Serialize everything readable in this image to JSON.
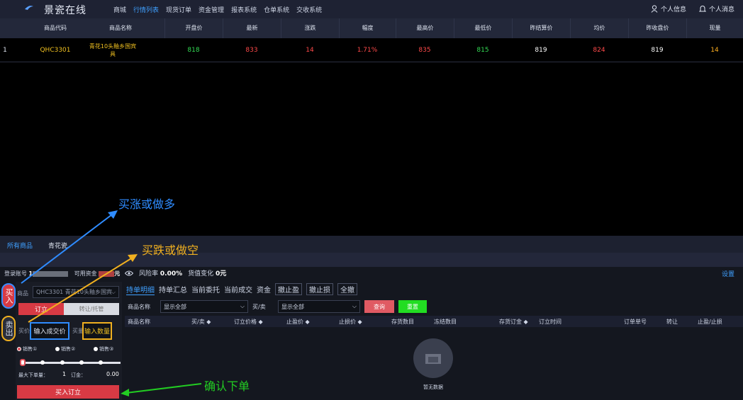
{
  "topbar": {
    "brand": "景瓷在线",
    "nav": [
      "商城",
      "行情列表",
      "现货订单",
      "资金管理",
      "报表系统",
      "仓单系统",
      "交收系统"
    ],
    "active_nav": 1,
    "user_info": "个人信息",
    "user_msg": "个人消息"
  },
  "market": {
    "headers": [
      "商品代码",
      "商品名称",
      "开盘价",
      "最新",
      "涨跌",
      "幅度",
      "最高价",
      "最低价",
      "昨结算价",
      "均价",
      "昨收盘价",
      "现量"
    ],
    "row": {
      "idx": "1",
      "code": "QHC3301",
      "name": "青花10头釉乡国宾具",
      "open": "818",
      "last": "833",
      "change": "14",
      "pct": "1.71%",
      "high": "835",
      "low": "815",
      "prev_settle": "819",
      "avg": "824",
      "prev_close": "819",
      "vol": "14"
    }
  },
  "band": {
    "tab_all": "所有商品",
    "tab_qhc": "青花瓷"
  },
  "account": {
    "login_label": "登录账号",
    "login_value": "1",
    "funds_label": "可用资金",
    "funds_unit": "元",
    "risk_label": "风险率",
    "risk_value": "0.00%",
    "change_label": "货值变化",
    "change_value": "0元",
    "settings": "设置"
  },
  "order": {
    "buy_tab": "买入",
    "sell_tab": "卖出",
    "product_label": "商品",
    "product_value": "QHC3301  青花10头釉乡国宾",
    "tab_order": "订立",
    "tab_transfer": "转让/托管",
    "price_label": "买价",
    "price_placeholder": "输入成交价",
    "qty_label": "买量",
    "qty_placeholder": "输入数量",
    "radios": [
      "销售①",
      "销售②",
      "销售③"
    ],
    "max_label": "最大下单量：",
    "max_value": "1",
    "order_label": "订金：",
    "order_value": "0.00",
    "submit": "买入订立"
  },
  "holdings": {
    "tabs": [
      "持单明细",
      "持单汇总",
      "当前委托",
      "当前成交",
      "资金",
      "撤止盈",
      "撤止损",
      "全撤"
    ],
    "filter_name_label": "商品名称",
    "filter_name_value": "显示全部",
    "filter_side_label": "买/卖",
    "filter_side_value": "显示全部",
    "btn_query": "查询",
    "btn_reset": "重置",
    "columns": [
      "商品名称",
      "买/卖 ◆",
      "订立价格 ◆",
      "止盈价 ◆",
      "止损价 ◆",
      "存货数目",
      "冻结数目",
      "存货订金 ◆",
      "订立时间",
      "订单单号",
      "转让",
      "止盈/止损"
    ],
    "empty": "暂无数据"
  },
  "annotations": {
    "long": "买涨或做多",
    "short": "买跌或做空",
    "confirm": "确认下单"
  }
}
